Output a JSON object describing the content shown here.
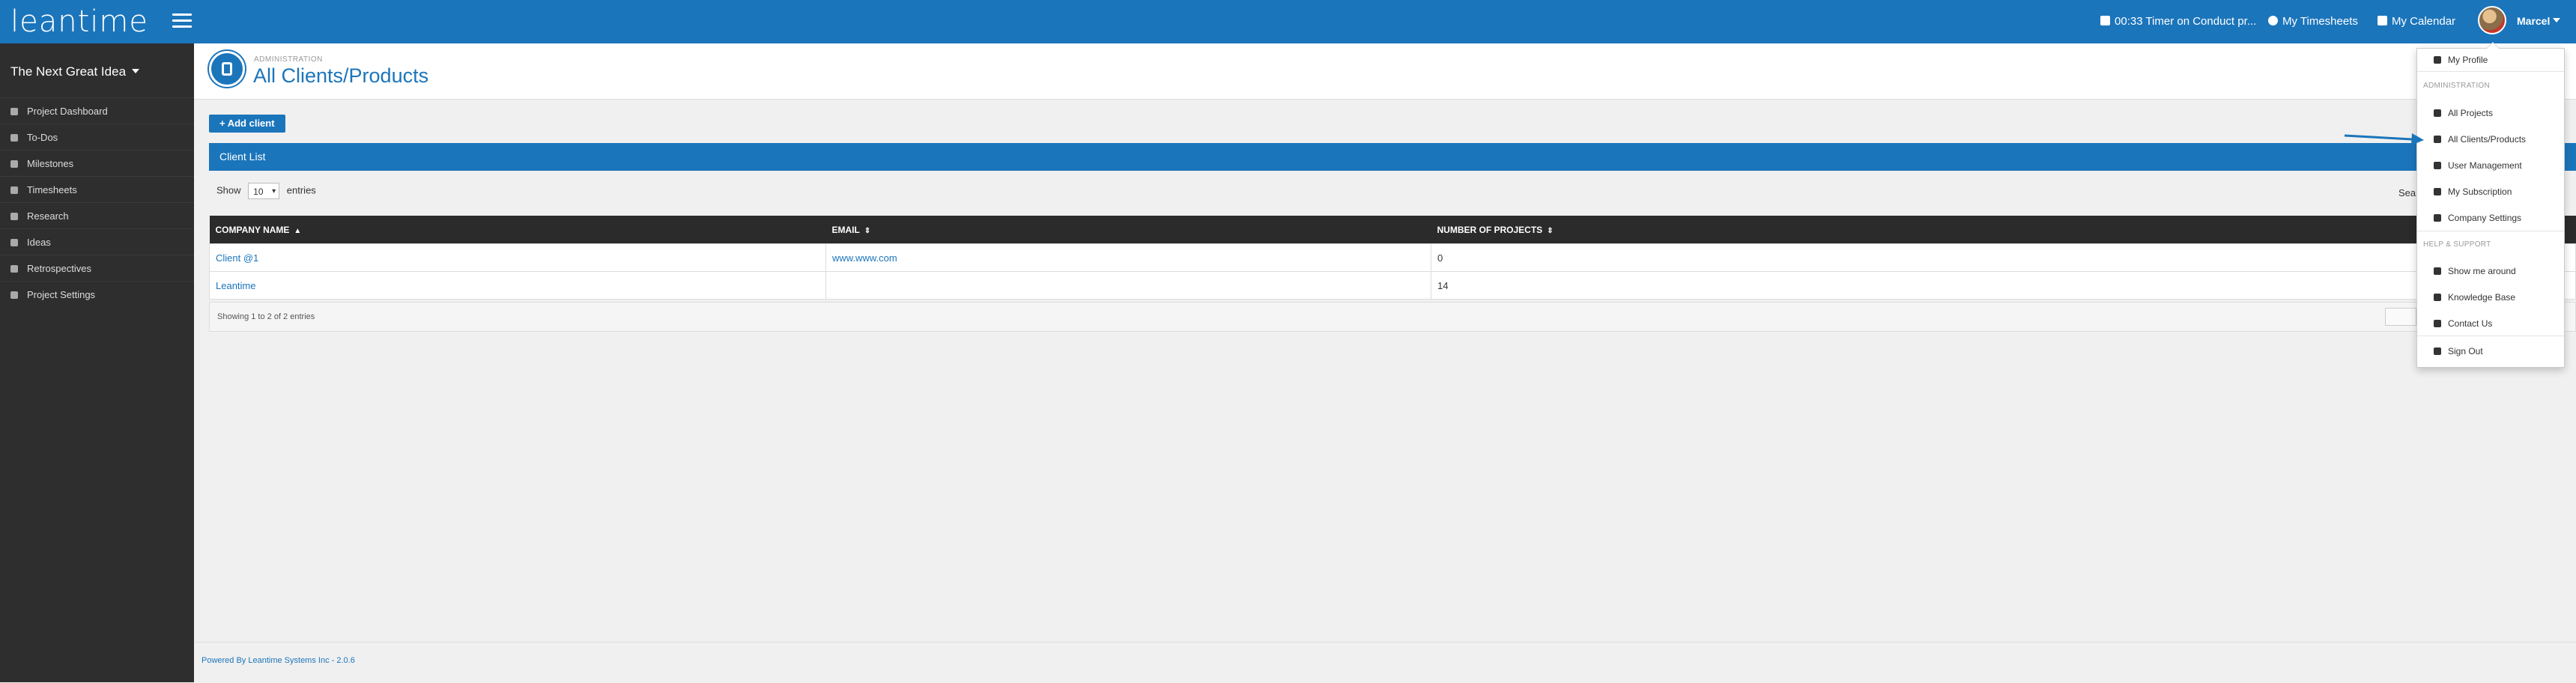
{
  "app": {
    "logo": "leantime",
    "brand_color": "#1b75bb"
  },
  "topbar": {
    "timer": "00:33 Timer on Conduct pr...",
    "timesheets": "My Timesheets",
    "calendar": "My Calendar",
    "user": "Marcel"
  },
  "sidebar": {
    "project": "The Next Great Idea",
    "items": [
      {
        "label": "Project Dashboard",
        "icon": "home-icon"
      },
      {
        "label": "To-Dos",
        "icon": "thumbtack-icon"
      },
      {
        "label": "Milestones",
        "icon": "sliders-icon"
      },
      {
        "label": "Timesheets",
        "icon": "clock-icon"
      },
      {
        "label": "Research",
        "icon": "user-icon"
      },
      {
        "label": "Ideas",
        "icon": "lightbulb-icon"
      },
      {
        "label": "Retrospectives",
        "icon": "retro-icon"
      },
      {
        "label": "Project Settings",
        "icon": "gear-icon"
      }
    ]
  },
  "header": {
    "subtitle": "ADMINISTRATION",
    "title": "All Clients/Products"
  },
  "actions": {
    "add_client": "+ Add client"
  },
  "panel": {
    "title": "Client List"
  },
  "table_controls": {
    "show": "Show",
    "entries_value": "10",
    "entries": "entries",
    "search": "Sear"
  },
  "table": {
    "columns": [
      "COMPANY NAME",
      "EMAIL",
      "NUMBER OF PROJECTS"
    ],
    "rows": [
      {
        "name": "Client @1",
        "email": "www.www.com",
        "projects": "0"
      },
      {
        "name": "Leantime",
        "email": "",
        "projects": "14"
      }
    ],
    "info": "Showing 1 to 2 of 2 entries"
  },
  "footer": {
    "text": "Powered By Leantime Systems Inc - 2.0.6"
  },
  "dropdown": {
    "profile": "My Profile",
    "admin_header": "ADMINISTRATION",
    "all_projects": "All Projects",
    "all_clients": "All Clients/Products",
    "user_mgmt": "User Management",
    "subscription": "My Subscription",
    "company_settings": "Company Settings",
    "help_header": "HELP & SUPPORT",
    "show_around": "Show me around",
    "kb": "Knowledge Base",
    "contact": "Contact Us",
    "sign_out": "Sign Out"
  }
}
